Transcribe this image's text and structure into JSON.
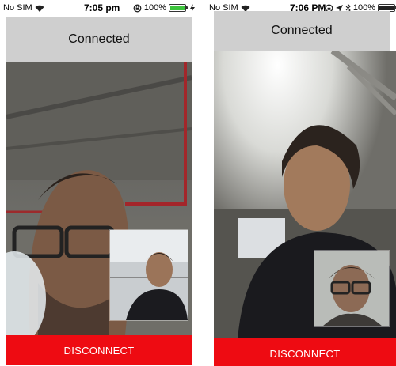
{
  "left_phone": {
    "status": {
      "carrier": "No SIM",
      "time": "7:05 pm",
      "battery": "100%"
    },
    "header_title": "Connected",
    "disconnect_label": "DISCONNECT"
  },
  "right_phone": {
    "status": {
      "carrier": "No SIM",
      "time": "7:06 PM",
      "battery": "100%"
    },
    "header_title": "Connected",
    "disconnect_label": "DISCONNECT"
  },
  "colors": {
    "header_bg": "#cfcfcf",
    "disconnect_bg": "#ee0b12",
    "battery": "#3cc43c"
  },
  "icons": [
    "wifi-icon",
    "rotation-lock-icon",
    "location-icon",
    "bluetooth-icon",
    "battery-icon",
    "charging-icon"
  ]
}
